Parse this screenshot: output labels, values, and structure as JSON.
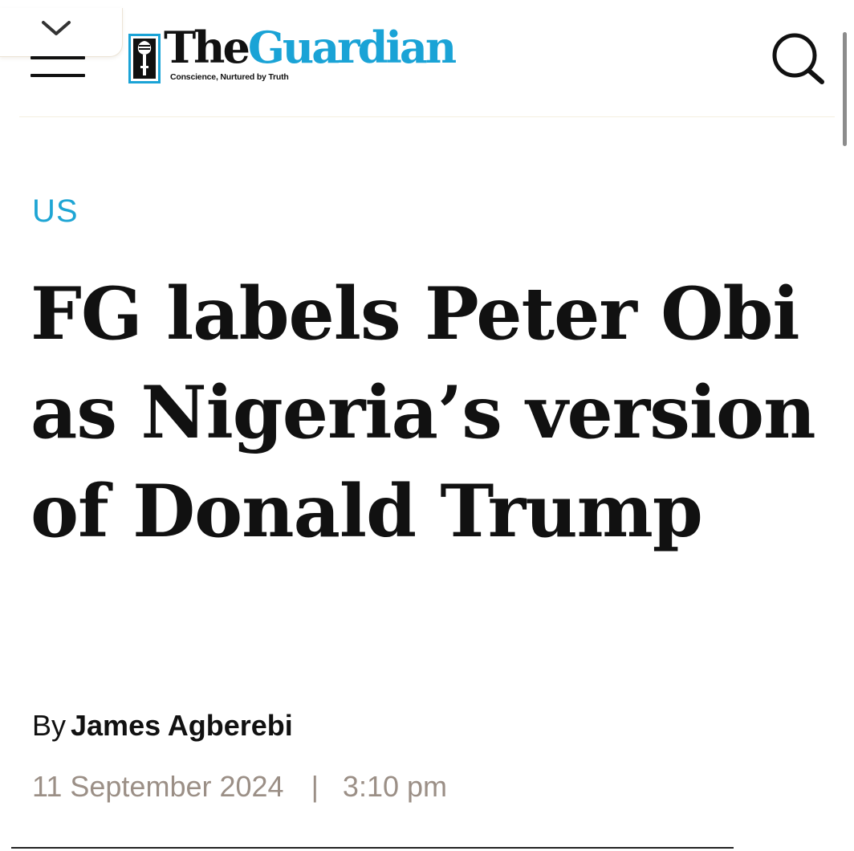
{
  "header": {
    "logo": {
      "word_the": "The",
      "word_guardian": "Guardian",
      "tagline": "Conscience, Nurtured by Truth"
    },
    "icons": {
      "collapse": "chevron-down-icon",
      "menu": "hamburger-menu-icon",
      "search": "search-icon"
    }
  },
  "article": {
    "category": "US",
    "headline": "FG labels Peter Obi as Nigeria’s version of Donald Trump",
    "byline_prefix": "By",
    "author": "James Agberebi",
    "date": "11 September 2024",
    "separator": "|",
    "time": "3:10 pm"
  },
  "colors": {
    "brand_blue": "#1aa3d6",
    "category_blue": "#1ea5d4",
    "text": "#111111",
    "meta_gray": "#9b8f86"
  }
}
